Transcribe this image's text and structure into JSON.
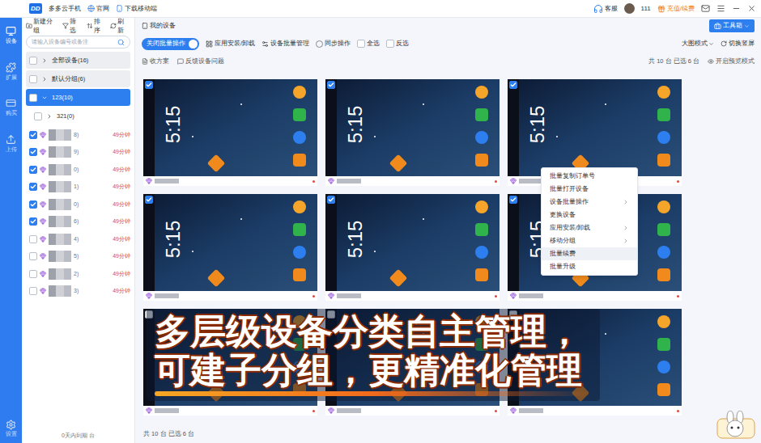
{
  "topbar": {
    "logo": "DD",
    "app_name": "多多云手机",
    "links": [
      "官网",
      "下载移动端"
    ],
    "support": "客服",
    "user": "111",
    "recharge": "充值/续费"
  },
  "rail": {
    "items": [
      {
        "label": "设备",
        "selected": true
      },
      {
        "label": "扩展",
        "selected": false
      },
      {
        "label": "购买",
        "selected": false
      },
      {
        "label": "上传",
        "selected": false
      }
    ],
    "settings": "设置"
  },
  "sidebar": {
    "tools": [
      "新建分组",
      "筛选",
      "排序",
      "刷新"
    ],
    "search_placeholder": "请输入设备编号或备注",
    "groups": [
      {
        "label": "全部设备(16)",
        "kind": "group",
        "selected": false,
        "checked": false,
        "expanded": false
      },
      {
        "label": "默认分组(6)",
        "kind": "group",
        "selected": false,
        "checked": false,
        "expanded": false
      },
      {
        "label": "123(10)",
        "kind": "group",
        "selected": true,
        "checked": false,
        "expanded": true
      },
      {
        "label": "321(0)",
        "kind": "subgroup",
        "selected": false,
        "checked": false,
        "expanded": false
      }
    ],
    "devices": [
      {
        "suffix": "8)",
        "time": "49分钟",
        "checked": true
      },
      {
        "suffix": "9)",
        "time": "49分钟",
        "checked": true
      },
      {
        "suffix": "0)",
        "time": "49分钟",
        "checked": true
      },
      {
        "suffix": "1)",
        "time": "49分钟",
        "checked": true
      },
      {
        "suffix": "0)",
        "time": "49分钟",
        "checked": true
      },
      {
        "suffix": "6)",
        "time": "49分钟",
        "checked": true
      },
      {
        "suffix": "4)",
        "time": "49分钟",
        "checked": false
      },
      {
        "suffix": "5)",
        "time": "49分钟",
        "checked": false
      },
      {
        "suffix": "2)",
        "time": "49分钟",
        "checked": false
      },
      {
        "suffix": "3)",
        "time": "49分钟",
        "checked": false
      }
    ],
    "footer": "0天内到期 台"
  },
  "main": {
    "breadcrumb": "我的设备",
    "toolbox": "工具箱",
    "batch_toggle": {
      "label": "关闭批量操作",
      "on": true
    },
    "actions": [
      {
        "label": "应用安装/卸载",
        "kind": "button",
        "checked": false
      },
      {
        "label": "设备批量管理",
        "kind": "button",
        "checked": false
      },
      {
        "label": "同步操作",
        "kind": "radio",
        "checked": false
      },
      {
        "label": "全选",
        "kind": "checkbox",
        "checked": false
      },
      {
        "label": "反选",
        "kind": "checkbox",
        "checked": false
      }
    ],
    "view_mode": "大图模式",
    "orientation": "切换竖屏",
    "sub_actions": [
      "收方案",
      "反馈设备问题"
    ],
    "total": "共 10 台",
    "selected_count": "已选 6 台",
    "preview": "开启预览模式",
    "cards": [
      {
        "time": "5:15",
        "checked": true
      },
      {
        "time": "5:15",
        "checked": true
      },
      {
        "time": "5:15",
        "checked": true
      },
      {
        "time": "5:15",
        "checked": true
      },
      {
        "time": "5:15",
        "checked": true
      },
      {
        "time": "5:15",
        "checked": true
      },
      {
        "time": "",
        "checked": false
      },
      {
        "time": "",
        "checked": false
      },
      {
        "time": "",
        "checked": false
      }
    ],
    "context_menu": [
      {
        "label": "批量复制订单号",
        "submenu": false,
        "selected": false
      },
      {
        "label": "批量打开设备",
        "submenu": false,
        "selected": false
      },
      {
        "label": "设备批量操作",
        "submenu": true,
        "selected": false
      },
      {
        "label": "更换设备",
        "submenu": false,
        "selected": false
      },
      {
        "label": "应用安装/卸载",
        "submenu": true,
        "selected": false
      },
      {
        "label": "移动分组",
        "submenu": true,
        "selected": false
      },
      {
        "label": "批量续费",
        "submenu": false,
        "selected": true
      },
      {
        "label": "批量升级",
        "submenu": false,
        "selected": false
      }
    ],
    "banner": [
      "多层级设备分类自主管理，",
      "可建子分组，更精准化管理"
    ]
  }
}
